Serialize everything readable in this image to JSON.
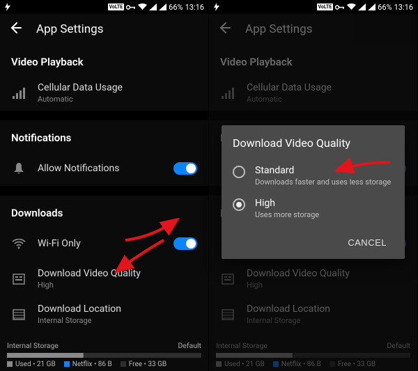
{
  "status": {
    "battery": "66%",
    "time": "13:16",
    "volte": "VoLTE"
  },
  "titlebar": {
    "title": "App Settings"
  },
  "sections": {
    "video": {
      "header": "Video Playback",
      "cellular": {
        "label": "Cellular Data Usage",
        "value": "Automatic"
      }
    },
    "notifications": {
      "header": "Notifications",
      "allow": "Allow Notifications"
    },
    "downloads": {
      "header": "Downloads",
      "wifi": "Wi-Fi Only",
      "quality": {
        "label": "Download Video Quality",
        "value": "High"
      },
      "location": {
        "label": "Download Location",
        "value": "Internal Storage"
      }
    }
  },
  "storage": {
    "label": "Internal Storage",
    "right": "Default",
    "used_label": "Used",
    "used_value": "21 GB",
    "netflix_label": "Netflix",
    "netflix_value": "86 B",
    "free_label": "Free",
    "free_value": "33 GB",
    "used_pct": 39,
    "netflix_pct": 0.5
  },
  "dialog": {
    "title": "Download Video Quality",
    "options": [
      {
        "name": "Standard",
        "desc": "Downloads faster and uses less storage",
        "checked": false
      },
      {
        "name": "High",
        "desc": "Uses more storage",
        "checked": true
      }
    ],
    "cancel": "CANCEL"
  }
}
